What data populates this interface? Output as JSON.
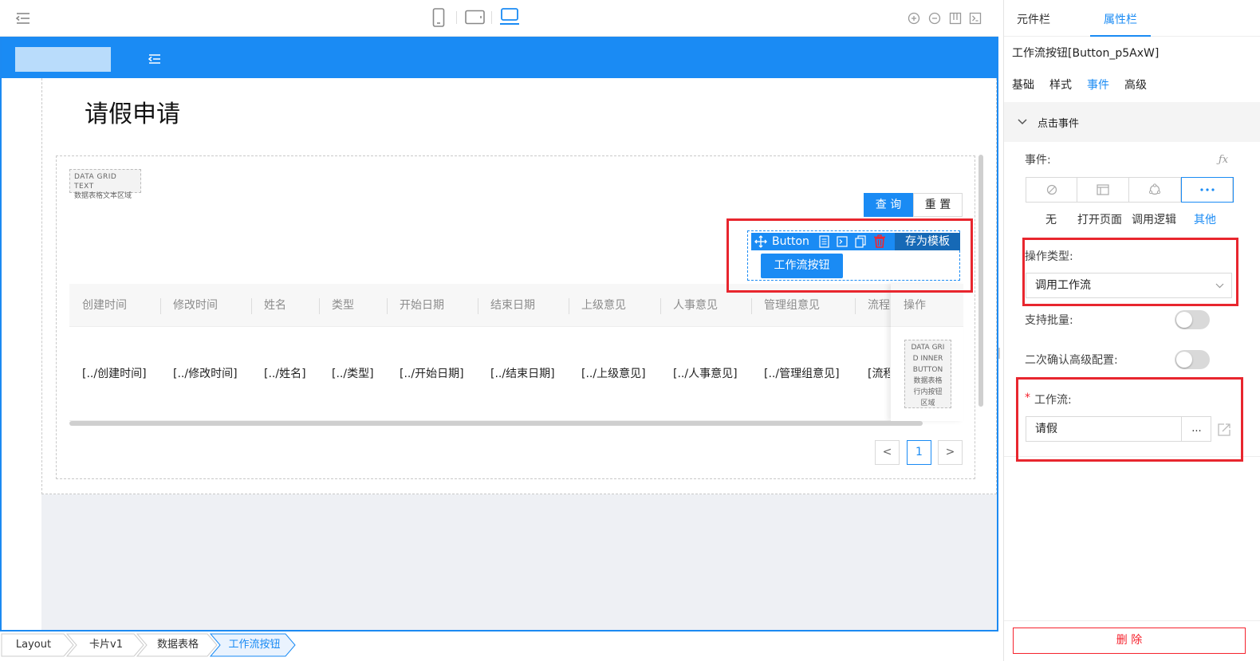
{
  "toolbar": {
    "icons": [
      "menu-fold-icon",
      "mobile-device-icon",
      "tablet-device-icon",
      "desktop-device-icon",
      "zoom-in-icon",
      "zoom-out-icon",
      "layout-icon",
      "code-icon"
    ]
  },
  "page": {
    "title": "请假申请",
    "grid_placeholder": {
      "line1": "DATA GRID TEXT",
      "line2": "数据表格文本区域"
    },
    "buttons": {
      "query": "查 询",
      "reset": "重 置"
    },
    "selection_toolbar": {
      "label": "Button",
      "save_template": "存为模板"
    },
    "workflow_button": "工作流按钮",
    "table": {
      "headers": [
        "创建时间",
        "修改时间",
        "姓名",
        "类型",
        "开始日期",
        "结束日期",
        "上级意见",
        "人事意见",
        "管理组意见",
        "流程",
        "操作"
      ],
      "row": [
        "[../创建时间]",
        "[../修改时间]",
        "[../姓名]",
        "[../类型]",
        "[../开始日期]",
        "[../结束日期]",
        "[../上级意见]",
        "[../人事意见]",
        "[../管理组意见]",
        "[流程"
      ],
      "inner_button_placeholder": [
        "DATA GRI",
        "D INNER",
        "BUTTON",
        "数据表格",
        "行内按钮",
        "区域"
      ]
    },
    "pagination": {
      "prev": "<",
      "current": "1",
      "next": ">"
    }
  },
  "breadcrumb": [
    "Layout",
    "卡片v1",
    "数据表格",
    "工作流按钮"
  ],
  "panel": {
    "tabs": [
      "元件栏",
      "属性栏"
    ],
    "active_tab": "属性栏",
    "component_title": "工作流按钮[Button_p5AxW]",
    "subtabs": [
      "基础",
      "样式",
      "事件",
      "高级"
    ],
    "active_subtab": "事件",
    "section_title": "点击事件",
    "event_label": "事件:",
    "event_options": [
      "无",
      "打开页面",
      "调用逻辑",
      "其他"
    ],
    "event_active": "其他",
    "action_type_label": "操作类型:",
    "action_type_value": "调用工作流",
    "batch_label": "支持批量:",
    "confirm_label": "二次确认高级配置:",
    "required_mark": "*",
    "workflow_label": "工作流:",
    "workflow_value": "请假",
    "ellipsis": "...",
    "delete_button": "删 除"
  },
  "colors": {
    "primary": "#1a8bf4",
    "highlight": "#e8262e",
    "danger": "#f5222d"
  }
}
